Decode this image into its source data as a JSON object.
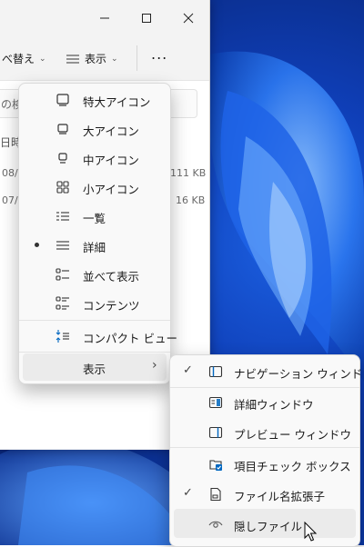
{
  "window": {
    "toolbar": {
      "sort_label": "べ替え",
      "view_label": "表示",
      "more_label": "..."
    },
    "search_placeholder": "の検",
    "column_header": "日時",
    "rows": [
      {
        "date": "08/",
        "size": "111 KB"
      },
      {
        "date": "07/",
        "size": "16 KB"
      }
    ]
  },
  "view_menu": {
    "items": [
      {
        "label": "特大アイコン",
        "icon": "monitor-xl-icon"
      },
      {
        "label": "大アイコン",
        "icon": "monitor-l-icon"
      },
      {
        "label": "中アイコン",
        "icon": "monitor-m-icon"
      },
      {
        "label": "小アイコン",
        "icon": "small-icons-grid-icon"
      },
      {
        "label": "一覧",
        "icon": "list-icon"
      },
      {
        "label": "詳細",
        "icon": "details-icon",
        "selected": true
      },
      {
        "label": "並べて表示",
        "icon": "tiles-icon"
      },
      {
        "label": "コンテンツ",
        "icon": "content-icon"
      },
      {
        "label": "コンパクト ビュー",
        "icon": "compact-view-icon"
      }
    ],
    "show_label": "表示",
    "show_chevron": "›"
  },
  "show_submenu": {
    "items": [
      {
        "label": "ナビゲーション ウィンドウ",
        "icon": "navigation-pane-icon",
        "checked": true
      },
      {
        "label": "詳細ウィンドウ",
        "icon": "details-pane-icon",
        "checked": false
      },
      {
        "label": "プレビュー ウィンドウ",
        "icon": "preview-pane-icon",
        "checked": false
      },
      {
        "label": "項目チェック ボックス",
        "icon": "item-checkbox-icon",
        "checked": false
      },
      {
        "label": "ファイル名拡張子",
        "icon": "file-extension-icon",
        "checked": true
      },
      {
        "label": "隠しファイル",
        "icon": "eye-icon",
        "checked": false
      }
    ],
    "check_glyph": "✓"
  },
  "colors": {
    "accent": "#0067c0",
    "wallpaper": "#1b5fe0"
  }
}
